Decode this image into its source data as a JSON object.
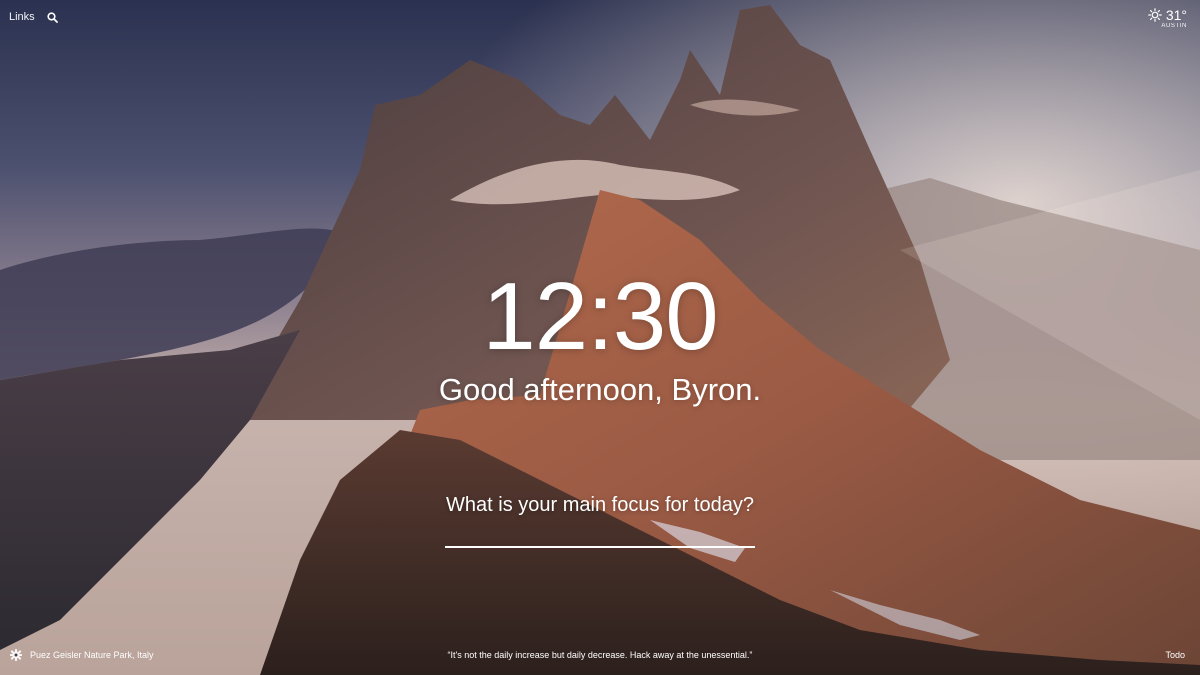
{
  "header": {
    "links_label": "Links",
    "search_icon": "search-icon"
  },
  "weather": {
    "temperature": "31°",
    "location": "AUSTIN",
    "icon": "sun-icon"
  },
  "main": {
    "time": "12:30",
    "greeting": "Good afternoon, Byron.",
    "focus_question": "What is your main focus for today?",
    "focus_value": ""
  },
  "footer": {
    "settings_icon": "gear-icon",
    "photo_location": "Puez Geisler Nature Park, Italy",
    "quote": "“It's not the daily increase but daily decrease. Hack away at the unessential.”",
    "todo_label": "Todo"
  },
  "colors": {
    "text": "#ffffff",
    "sky_top": "#2f3553",
    "rock_light": "#b06c52",
    "rock_dark": "#3a2b26"
  }
}
